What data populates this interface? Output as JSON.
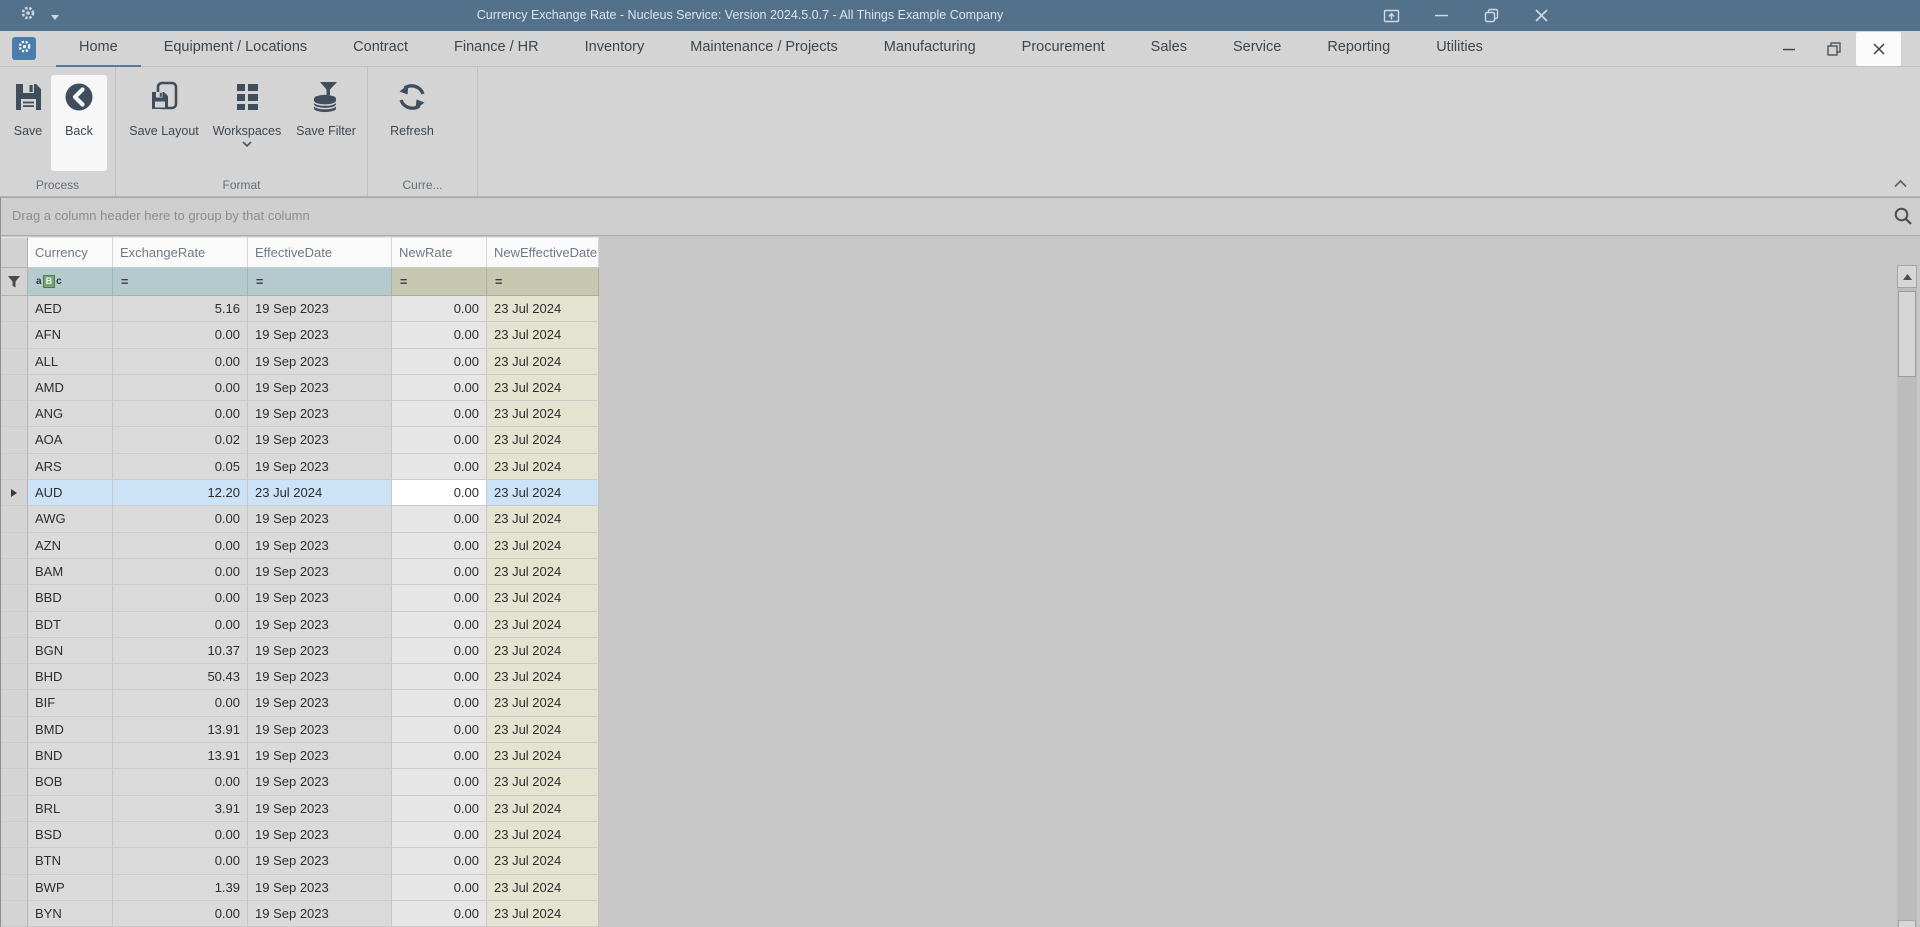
{
  "window": {
    "title": "Currency Exchange Rate - Nucleus Service: Version 2024.5.0.7 - All Things Example Company"
  },
  "menu": {
    "tabs": [
      {
        "label": "Home",
        "active": true
      },
      {
        "label": "Equipment / Locations",
        "active": false
      },
      {
        "label": "Contract",
        "active": false
      },
      {
        "label": "Finance / HR",
        "active": false
      },
      {
        "label": "Inventory",
        "active": false
      },
      {
        "label": "Maintenance / Projects",
        "active": false
      },
      {
        "label": "Manufacturing",
        "active": false
      },
      {
        "label": "Procurement",
        "active": false
      },
      {
        "label": "Sales",
        "active": false
      },
      {
        "label": "Service",
        "active": false
      },
      {
        "label": "Reporting",
        "active": false
      },
      {
        "label": "Utilities",
        "active": false
      }
    ]
  },
  "ribbon": {
    "buttons": [
      {
        "label": "Save",
        "icon": "save-floppy-icon",
        "highlighted": false
      },
      {
        "label": "Back",
        "icon": "back-circle-icon",
        "highlighted": true
      },
      {
        "label": "Save Layout",
        "icon": "save-layout-icon",
        "highlighted": false
      },
      {
        "label": "Workspaces",
        "icon": "workspaces-grid-icon",
        "highlighted": false,
        "has_dropdown": true
      },
      {
        "label": "Save Filter",
        "icon": "save-filter-icon",
        "highlighted": false
      },
      {
        "label": "Refresh",
        "icon": "refresh-icon",
        "highlighted": false
      }
    ],
    "groups": [
      "Process",
      "Format",
      "Curre..."
    ]
  },
  "group_panel": {
    "text": "Drag a column header here to group by that column"
  },
  "grid": {
    "columns": [
      "Currency",
      "ExchangeRate",
      "EffectiveDate",
      "NewRate",
      "NewEffectiveDate"
    ],
    "filter_row": {
      "text_filter_icon": "aBc",
      "operators": [
        "=",
        "=",
        "=",
        "="
      ]
    },
    "selected_row": "AUD",
    "rows": [
      {
        "currency": "AED",
        "exchange_rate": "5.16",
        "effective_date": "19 Sep 2023",
        "new_rate": "0.00",
        "new_effective_date": "23 Jul 2024"
      },
      {
        "currency": "AFN",
        "exchange_rate": "0.00",
        "effective_date": "19 Sep 2023",
        "new_rate": "0.00",
        "new_effective_date": "23 Jul 2024"
      },
      {
        "currency": "ALL",
        "exchange_rate": "0.00",
        "effective_date": "19 Sep 2023",
        "new_rate": "0.00",
        "new_effective_date": "23 Jul 2024"
      },
      {
        "currency": "AMD",
        "exchange_rate": "0.00",
        "effective_date": "19 Sep 2023",
        "new_rate": "0.00",
        "new_effective_date": "23 Jul 2024"
      },
      {
        "currency": "ANG",
        "exchange_rate": "0.00",
        "effective_date": "19 Sep 2023",
        "new_rate": "0.00",
        "new_effective_date": "23 Jul 2024"
      },
      {
        "currency": "AOA",
        "exchange_rate": "0.02",
        "effective_date": "19 Sep 2023",
        "new_rate": "0.00",
        "new_effective_date": "23 Jul 2024"
      },
      {
        "currency": "ARS",
        "exchange_rate": "0.05",
        "effective_date": "19 Sep 2023",
        "new_rate": "0.00",
        "new_effective_date": "23 Jul 2024"
      },
      {
        "currency": "AUD",
        "exchange_rate": "12.20",
        "effective_date": "23 Jul 2024",
        "new_rate": "0.00",
        "new_effective_date": "23 Jul 2024",
        "selected": true
      },
      {
        "currency": "AWG",
        "exchange_rate": "0.00",
        "effective_date": "19 Sep 2023",
        "new_rate": "0.00",
        "new_effective_date": "23 Jul 2024"
      },
      {
        "currency": "AZN",
        "exchange_rate": "0.00",
        "effective_date": "19 Sep 2023",
        "new_rate": "0.00",
        "new_effective_date": "23 Jul 2024"
      },
      {
        "currency": "BAM",
        "exchange_rate": "0.00",
        "effective_date": "19 Sep 2023",
        "new_rate": "0.00",
        "new_effective_date": "23 Jul 2024"
      },
      {
        "currency": "BBD",
        "exchange_rate": "0.00",
        "effective_date": "19 Sep 2023",
        "new_rate": "0.00",
        "new_effective_date": "23 Jul 2024"
      },
      {
        "currency": "BDT",
        "exchange_rate": "0.00",
        "effective_date": "19 Sep 2023",
        "new_rate": "0.00",
        "new_effective_date": "23 Jul 2024"
      },
      {
        "currency": "BGN",
        "exchange_rate": "10.37",
        "effective_date": "19 Sep 2023",
        "new_rate": "0.00",
        "new_effective_date": "23 Jul 2024"
      },
      {
        "currency": "BHD",
        "exchange_rate": "50.43",
        "effective_date": "19 Sep 2023",
        "new_rate": "0.00",
        "new_effective_date": "23 Jul 2024"
      },
      {
        "currency": "BIF",
        "exchange_rate": "0.00",
        "effective_date": "19 Sep 2023",
        "new_rate": "0.00",
        "new_effective_date": "23 Jul 2024"
      },
      {
        "currency": "BMD",
        "exchange_rate": "13.91",
        "effective_date": "19 Sep 2023",
        "new_rate": "0.00",
        "new_effective_date": "23 Jul 2024"
      },
      {
        "currency": "BND",
        "exchange_rate": "13.91",
        "effective_date": "19 Sep 2023",
        "new_rate": "0.00",
        "new_effective_date": "23 Jul 2024"
      },
      {
        "currency": "BOB",
        "exchange_rate": "0.00",
        "effective_date": "19 Sep 2023",
        "new_rate": "0.00",
        "new_effective_date": "23 Jul 2024"
      },
      {
        "currency": "BRL",
        "exchange_rate": "3.91",
        "effective_date": "19 Sep 2023",
        "new_rate": "0.00",
        "new_effective_date": "23 Jul 2024"
      },
      {
        "currency": "BSD",
        "exchange_rate": "0.00",
        "effective_date": "19 Sep 2023",
        "new_rate": "0.00",
        "new_effective_date": "23 Jul 2024"
      },
      {
        "currency": "BTN",
        "exchange_rate": "0.00",
        "effective_date": "19 Sep 2023",
        "new_rate": "0.00",
        "new_effective_date": "23 Jul 2024"
      },
      {
        "currency": "BWP",
        "exchange_rate": "1.39",
        "effective_date": "19 Sep 2023",
        "new_rate": "0.00",
        "new_effective_date": "23 Jul 2024"
      },
      {
        "currency": "BYN",
        "exchange_rate": "0.00",
        "effective_date": "19 Sep 2023",
        "new_rate": "0.00",
        "new_effective_date": "23 Jul 2024"
      }
    ]
  },
  "colors": {
    "titlebar": "#54718b",
    "accent_blue": "#4a7dab",
    "tab_underline": "#4e7ca8",
    "selected_row": "#cbe2f7",
    "filter_teal": "#b5cacd",
    "filter_khaki": "#c6c8b2",
    "khaki_column": "#e3e3cf"
  }
}
